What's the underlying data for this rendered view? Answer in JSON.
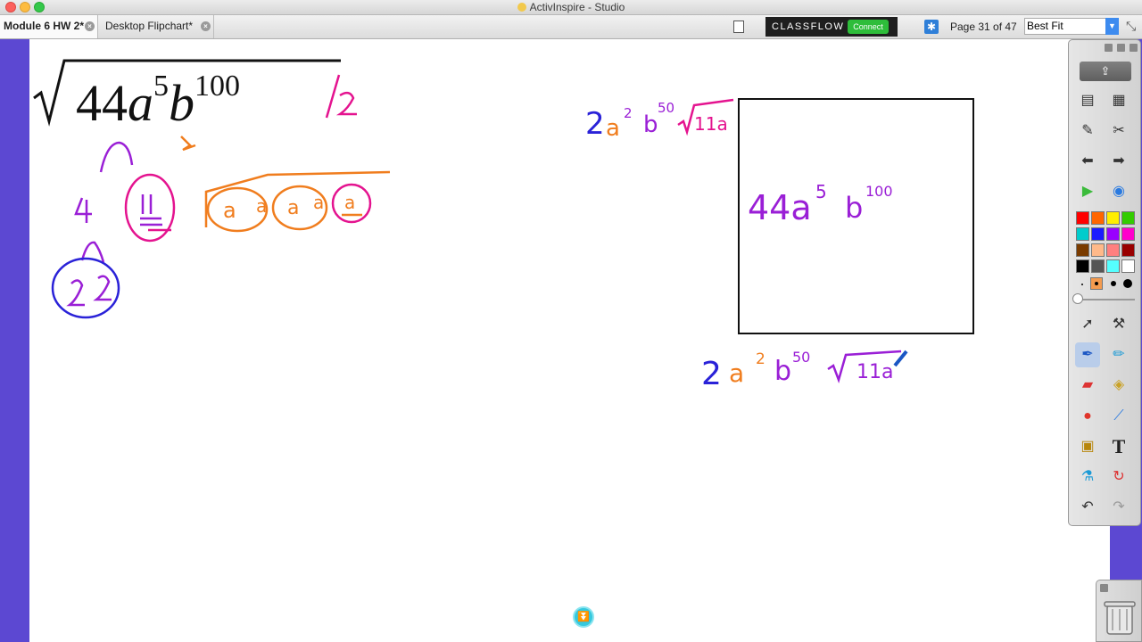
{
  "window": {
    "title": "ActivInspire - Studio"
  },
  "tabs": [
    {
      "label": "Module 6 HW 2*"
    },
    {
      "label": "Desktop Flipchart*"
    }
  ],
  "toolbar": {
    "classflow_label": "CLASSFLOW",
    "connect_label": "Connect",
    "page_indicator": "Page 31 of 47",
    "zoom_value": "Best Fit"
  },
  "colors": {
    "accent": "#5c48d2",
    "ink_black": "#111111",
    "ink_blue": "#2a22d8",
    "ink_orange": "#f07d1e",
    "ink_magenta": "#e4138f",
    "ink_purple": "#9a1fd6"
  },
  "flipchart": {
    "expression_typed": "44a5b100"
  },
  "palette": [
    "#ff0000",
    "#ff6600",
    "#ffee00",
    "#33cc00",
    "#00cccc",
    "#1a1aff",
    "#9900ff",
    "#ff00cc",
    "#7a3b00",
    "#ffb98a",
    "#ff7f7f",
    "#990000",
    "#000000",
    "#555555",
    "#55ffff",
    "#ffffff"
  ],
  "icons": {
    "notes": "notes-icon",
    "flake": "page-browser-icon",
    "collapse": "collapse-icon",
    "export": "export-icon",
    "trash": "trash-icon",
    "page_nav": "page-down-icon"
  }
}
